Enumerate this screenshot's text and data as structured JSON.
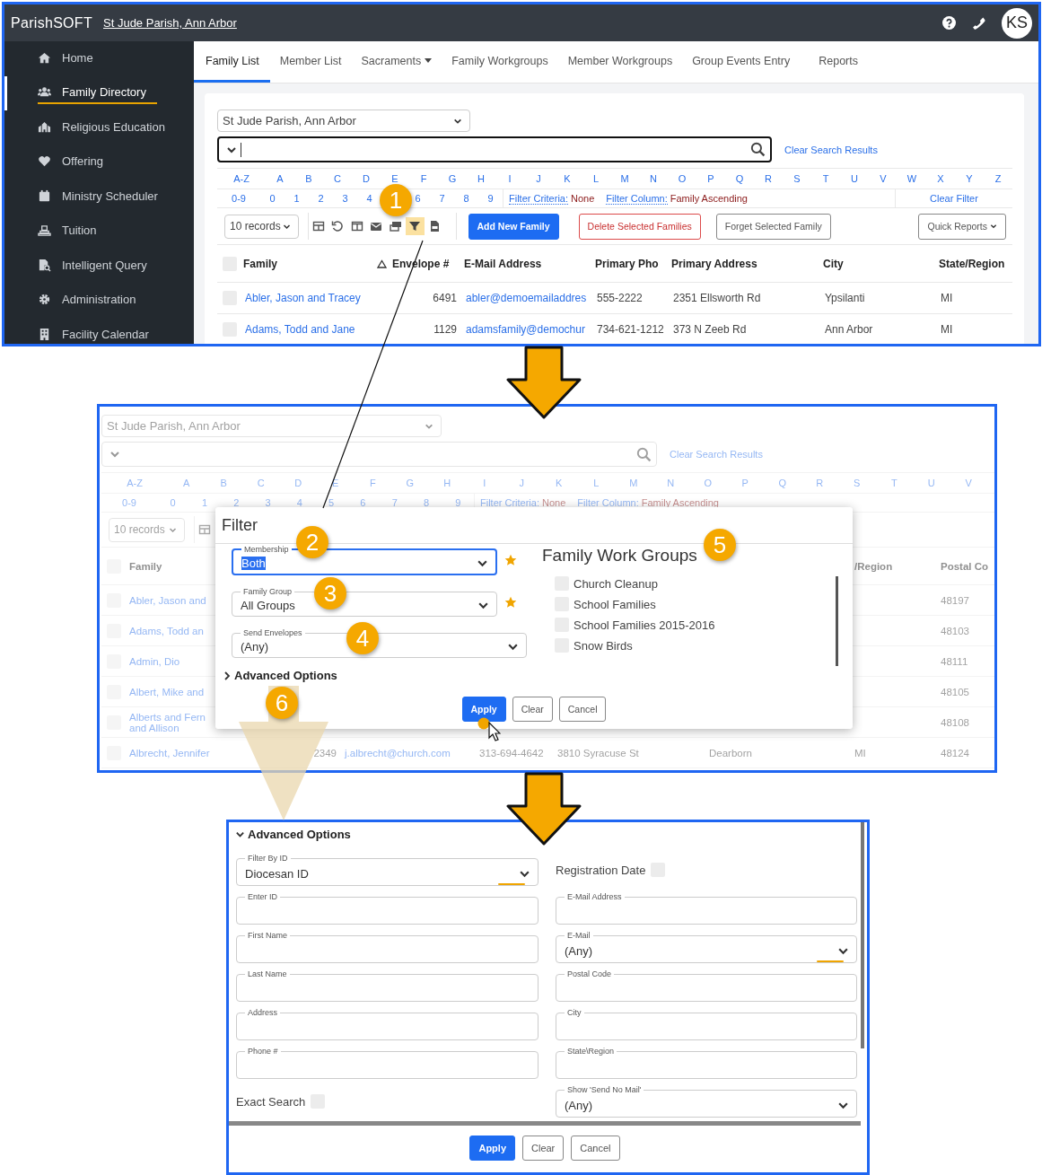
{
  "directory": {
    "logo": "ParishSOFT",
    "parish_link": "St Jude Parish, Ann Arbor",
    "avatar": "KS",
    "sidebar": [
      {
        "label": "Home",
        "selected": false
      },
      {
        "label": "Family Directory",
        "selected": true
      },
      {
        "label": "Religious Education",
        "selected": false
      },
      {
        "label": "Offering",
        "selected": false
      },
      {
        "label": "Ministry Scheduler",
        "selected": false
      },
      {
        "label": "Tuition",
        "selected": false
      },
      {
        "label": "Intelligent Query",
        "selected": false
      },
      {
        "label": "Administration",
        "selected": false
      },
      {
        "label": "Facility Calendar",
        "selected": false
      }
    ],
    "tabs": [
      {
        "label": "Family List",
        "selected": true,
        "dropdown": false
      },
      {
        "label": "Member List",
        "selected": false,
        "dropdown": false
      },
      {
        "label": "Sacraments",
        "selected": false,
        "dropdown": true
      },
      {
        "label": "Family Workgroups",
        "selected": false,
        "dropdown": false
      },
      {
        "label": "Member Workgroups",
        "selected": false,
        "dropdown": false
      },
      {
        "label": "Group Events Entry",
        "selected": false,
        "dropdown": false
      },
      {
        "label": "Reports",
        "selected": false,
        "dropdown": false
      }
    ],
    "parish_select": "St Jude Parish, Ann Arbor",
    "search": {
      "focused": true
    },
    "clear_search": "Clear Search Results",
    "letters": [
      "A-Z",
      "A",
      "B",
      "C",
      "D",
      "E",
      "F",
      "G",
      "H",
      "I",
      "J",
      "K",
      "L",
      "M",
      "N",
      "O",
      "P",
      "Q",
      "R",
      "S",
      "T",
      "U",
      "V",
      "W",
      "X",
      "Y",
      "Z"
    ],
    "digits": [
      "0-9",
      "0",
      "1",
      "2",
      "3",
      "4",
      "6",
      "7",
      "8",
      "9"
    ],
    "filter_criteria": {
      "label": "Filter Criteria:",
      "value": "None"
    },
    "filter_column": {
      "label": "Filter Column:",
      "value": "Family Ascending"
    },
    "clear_filter": "Clear Filter",
    "records": "10 records",
    "tools": [
      {
        "kind": "table",
        "highlighted": false
      },
      {
        "kind": "undo",
        "highlighted": false
      },
      {
        "kind": "columns",
        "highlighted": false
      },
      {
        "kind": "envelope",
        "highlighted": false
      },
      {
        "kind": "envelopes",
        "highlighted": false
      },
      {
        "kind": "filter",
        "highlighted": true
      },
      {
        "kind": "file",
        "highlighted": false
      }
    ],
    "buttons": [
      {
        "label": "Add New Family",
        "kind": "primary"
      },
      {
        "label": "Delete Selected Families",
        "kind": "danger"
      },
      {
        "label": "Forget Selected Family",
        "kind": "outline"
      },
      {
        "label": "Quick Reports",
        "kind": "menu"
      }
    ],
    "table": {
      "all_checked": false,
      "columns": [
        {
          "label": "Family",
          "kind": "link",
          "sorted": true
        },
        {
          "label": "Envelope #",
          "kind": "number",
          "sorted": false
        },
        {
          "label": "E-Mail Address",
          "kind": "link",
          "sorted": false
        },
        {
          "label": "Primary Pho",
          "kind": "text",
          "sorted": false
        },
        {
          "label": "Primary Address",
          "kind": "text",
          "sorted": false
        },
        {
          "label": "City",
          "kind": "text",
          "sorted": false
        },
        {
          "label": "State/Region",
          "kind": "text",
          "sorted": false
        }
      ],
      "rows": [
        {
          "checked": false,
          "cells": [
            "Abler, Jason and Tracey",
            "6491",
            "abler@demoemailaddres",
            "555-2222",
            "2351 Ellsworth Rd",
            "Ypsilanti",
            "MI"
          ]
        },
        {
          "checked": false,
          "cells": [
            "Adams, Todd and Jane",
            "1129",
            "adamsfamily@demochur",
            "734-621-1212",
            "373 N Zeeb Rd",
            "Ann Arbor",
            "MI"
          ]
        }
      ]
    }
  },
  "filter_screen": {
    "parish_select": "St Jude Parish, Ann Arbor",
    "search": {
      "focused": false
    },
    "clear_search": "Clear Search Results",
    "letters": [
      "A-Z",
      "A",
      "B",
      "C",
      "D",
      "E",
      "F",
      "G",
      "H",
      "I",
      "J",
      "K",
      "L",
      "M",
      "N",
      "O",
      "P",
      "Q",
      "R",
      "S",
      "T",
      "U",
      "V"
    ],
    "digits": [
      "0-9",
      "0",
      "1",
      "2",
      "3",
      "4",
      "5",
      "6",
      "7",
      "8",
      "9"
    ],
    "filter_criteria": {
      "label": "Filter Criteria:",
      "value": "None"
    },
    "filter_column": {
      "label": "Filter Column:",
      "value": "Family Ascending"
    },
    "records": "10 records",
    "tools": [
      {
        "kind": "table",
        "highlighted": false
      }
    ],
    "table": {
      "all_checked": false,
      "columns": [
        {
          "label": "Family",
          "kind": "link"
        },
        {
          "kind": "number"
        },
        {
          "kind": "link"
        },
        {
          "kind": "text"
        },
        {
          "kind": "text"
        },
        {
          "kind": "text"
        },
        {
          "label": "/Region",
          "kind": "text"
        },
        {
          "label": "Postal Co",
          "kind": "text"
        }
      ],
      "rows": [
        {
          "checked": false,
          "cells": [
            "Abler, Jason and",
            null,
            null,
            null,
            null,
            null,
            null,
            "48197"
          ]
        },
        {
          "checked": false,
          "cells": [
            "Adams, Todd an",
            null,
            null,
            null,
            null,
            null,
            null,
            "48103"
          ]
        },
        {
          "checked": false,
          "cells": [
            "Admin, Dio",
            null,
            null,
            null,
            null,
            null,
            null,
            "48111"
          ]
        },
        {
          "checked": false,
          "cells": [
            "Albert, Mike and",
            null,
            null,
            null,
            null,
            null,
            null,
            "48105"
          ]
        },
        {
          "checked": false,
          "cells": [
            "Alberts and Fern\nand Allison",
            null,
            null,
            null,
            null,
            null,
            null,
            "48108"
          ]
        },
        {
          "checked": false,
          "cells": [
            "Albrecht, Jennifer",
            "2349",
            "j.albrecht@church.com",
            "313-694-4642",
            "3810 Syracuse St",
            "Dearborn",
            "MI",
            "48124"
          ]
        }
      ]
    },
    "modal": {
      "title": "Filter",
      "fields": [
        {
          "label": "Membership",
          "value": "Both",
          "focused": true,
          "starred": true
        },
        {
          "label": "Family Group",
          "value": "All Groups",
          "focused": false,
          "starred": true
        },
        {
          "label": "Send Envelopes",
          "value": "(Any)",
          "focused": false,
          "starred": false
        }
      ],
      "advanced": {
        "label": "Advanced Options",
        "expanded": false
      },
      "groups_title": "Family Work Groups",
      "groups": [
        {
          "label": "Church Cleanup",
          "checked": false
        },
        {
          "label": "School Families",
          "checked": false
        },
        {
          "label": "School Families 2015-2016",
          "checked": false
        },
        {
          "label": "Snow Birds",
          "checked": false
        }
      ],
      "buttons": [
        {
          "label": "Apply",
          "kind": "primary"
        },
        {
          "label": "Clear",
          "kind": "outline"
        },
        {
          "label": "Cancel",
          "kind": "outline"
        }
      ]
    }
  },
  "advanced_options": {
    "toggle": {
      "label": "Advanced Options",
      "expanded": true
    },
    "fields": [
      {
        "kind": "select",
        "label": "Filter By ID",
        "value": "Diocesan ID",
        "accent": true
      },
      {
        "kind": "checkbox",
        "label": "Registration Date",
        "checked": false
      },
      {
        "kind": "input",
        "label": "Enter ID"
      },
      {
        "kind": "input",
        "label": "E-Mail Address"
      },
      {
        "kind": "input",
        "label": "First Name"
      },
      {
        "kind": "select",
        "label": "E-Mail",
        "value": "(Any)",
        "accent": true
      },
      {
        "kind": "input",
        "label": "Last Name"
      },
      {
        "kind": "input",
        "label": "Postal Code"
      },
      {
        "kind": "input",
        "label": "Address"
      },
      {
        "kind": "input",
        "label": "City"
      },
      {
        "kind": "input",
        "label": "Phone #"
      },
      {
        "kind": "input",
        "label": "State\\Region"
      },
      {
        "kind": "checkbox",
        "label": "Exact Search",
        "checked": false
      },
      {
        "kind": "select",
        "label": "Show 'Send No Mail'",
        "value": "(Any)",
        "accent": false
      }
    ],
    "buttons": [
      {
        "label": "Apply",
        "kind": "primary"
      },
      {
        "label": "Clear",
        "kind": "outline"
      },
      {
        "label": "Cancel",
        "kind": "outline"
      }
    ]
  },
  "callouts": [
    {
      "label": "1"
    },
    {
      "label": "2"
    },
    {
      "label": "3"
    },
    {
      "label": "4"
    },
    {
      "label": "5"
    },
    {
      "label": "6"
    }
  ]
}
